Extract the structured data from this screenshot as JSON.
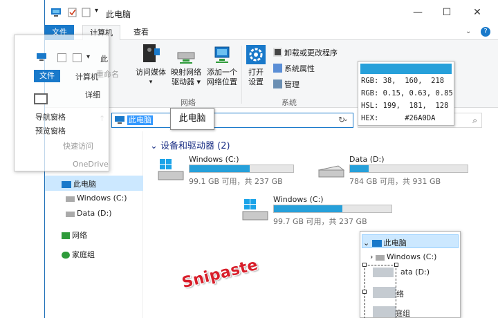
{
  "window": {
    "title": "此电脑",
    "controls": [
      "—",
      "☐",
      "✕"
    ]
  },
  "menu": {
    "file": "文件",
    "computer": "计算机",
    "view": "查看"
  },
  "ribbon": {
    "access_media": "访问媒体",
    "map_drive_1": "映射网络",
    "map_drive_2": "驱动器",
    "add_location_1": "添加一个",
    "add_location_2": "网络位置",
    "open_settings_1": "打开",
    "open_settings_2": "设置",
    "uninstall": "卸载或更改程序",
    "system_properties": "系统属性",
    "manage": "管理",
    "group_network": "网络",
    "group_system": "系统"
  },
  "address": {
    "selected": "此电脑",
    "tooltip": "此电脑"
  },
  "color_picker": {
    "hex_value": "#26A0DA",
    "rows": [
      {
        "label": "RGB:",
        "value": "38,  160,  218"
      },
      {
        "label": "RGB:",
        "value": "0.15, 0.63, 0.85"
      },
      {
        "label": "HSL:",
        "value": "199,  181,  128"
      },
      {
        "label": "HEX:",
        "value": "#26A0DA"
      }
    ]
  },
  "snip_overlay": {
    "file_tab": "文件",
    "computer_tab": "计算机",
    "partial_title": "此",
    "rename": "重命名",
    "details": "详细",
    "nav_pane": "导航窗格",
    "preview_pane": "预览窗格",
    "quick_access": "快速访问",
    "onedrive": "OneDrive"
  },
  "nav": {
    "this_pc": "此电脑",
    "windows_c": "Windows (C:)",
    "data_d": "Data (D:)",
    "network": "网络",
    "homegroup": "家庭组"
  },
  "content": {
    "section_title": "设备和驱动器 (2)",
    "drives": [
      {
        "name": "Windows (C:)",
        "free": "99.1 GB 可用，共 237 GB",
        "used_fraction": 0.58
      },
      {
        "name": "Data (D:)",
        "free": "784 GB 可用，共 931 GB",
        "used_fraction": 0.16
      },
      {
        "name": "Windows (C:)",
        "free": "99.7 GB 可用，共 237 GB",
        "used_fraction": 0.58
      }
    ]
  },
  "tree_popup": {
    "this_pc": "此电脑",
    "windows_c": "Windows (C:)",
    "data_d": "ata (D:)",
    "network_partial": "络",
    "homegroup_partial": "庭组"
  },
  "logo_text": "Snipaste",
  "colors": {
    "accent": "#1979CA",
    "drive_bar": "#26A0DA",
    "selection": "#CCE8FF"
  }
}
